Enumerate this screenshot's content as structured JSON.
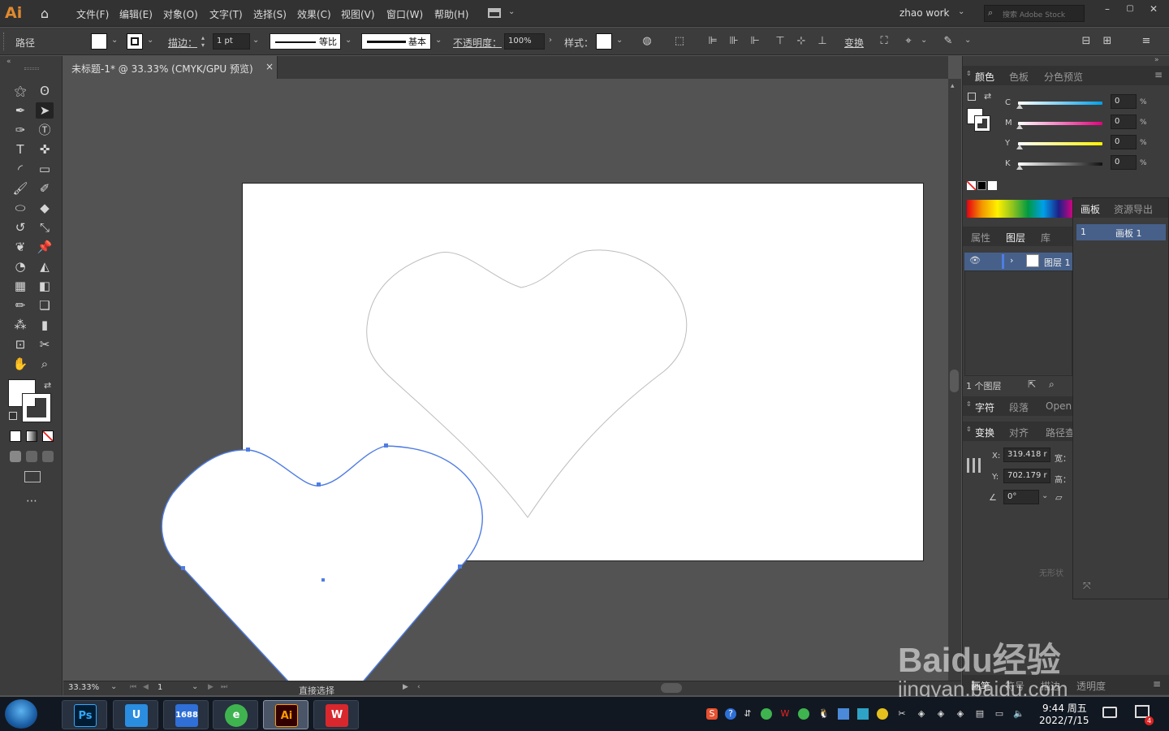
{
  "app": {
    "logo": "Ai",
    "menus": [
      "文件(F)",
      "编辑(E)",
      "对象(O)",
      "文字(T)",
      "选择(S)",
      "效果(C)",
      "视图(V)",
      "窗口(W)",
      "帮助(H)"
    ],
    "workspace": "zhao work",
    "search_placeholder": "搜索 Adobe Stock"
  },
  "control": {
    "object_type": "路径",
    "stroke_label": "描边：",
    "stroke_weight": "1 pt",
    "profile_label": "等比",
    "brush_label": "基本",
    "opacity_label": "不透明度：",
    "opacity_value": "100%",
    "style_label": "样式：",
    "transform_label": "变换"
  },
  "document": {
    "tab_title": "未标题-1* @ 33.33% (CMYK/GPU 预览)",
    "close": "×"
  },
  "status": {
    "zoom": "33.33%",
    "artboard_num": "1",
    "tool_name": "直接选择"
  },
  "panels": {
    "color_tabs": [
      "颜色",
      "色板",
      "分色预览"
    ],
    "cmyk": [
      {
        "label": "C",
        "value": "0",
        "unit": "%"
      },
      {
        "label": "M",
        "value": "0",
        "unit": "%"
      },
      {
        "label": "Y",
        "value": "0",
        "unit": "%"
      },
      {
        "label": "K",
        "value": "0",
        "unit": "%"
      }
    ],
    "layer_tabs": [
      "属性",
      "图层",
      "库"
    ],
    "layer_name": "图层 1",
    "layer_count": "1 个图层",
    "char_tabs": [
      "字符",
      "段落",
      "Open"
    ],
    "transform_tabs": [
      "变换",
      "对齐",
      "路径查"
    ],
    "x_label": "X:",
    "x_value": "319.418 r",
    "y_label": "Y:",
    "y_value": "702.179 r",
    "w_label": "宽：",
    "h_label": "高：",
    "angle_value": "0°",
    "artboard_tabs": [
      "画板",
      "资源导出"
    ],
    "artboard_row_num": "1",
    "artboard_row_name": "画板 1",
    "no_state": "无形状"
  },
  "bottom_tabs": [
    "画笔",
    "符号",
    "描边",
    "透明度"
  ],
  "taskbar": {
    "apps": [
      "Ps",
      "U",
      "1688",
      "e",
      "Ai",
      "W"
    ],
    "time": "9:44 周五",
    "date": "2022/7/15",
    "badge": "4"
  },
  "watermark": {
    "brand": "Baidu经验",
    "url": "jingyan.baidu.com"
  }
}
